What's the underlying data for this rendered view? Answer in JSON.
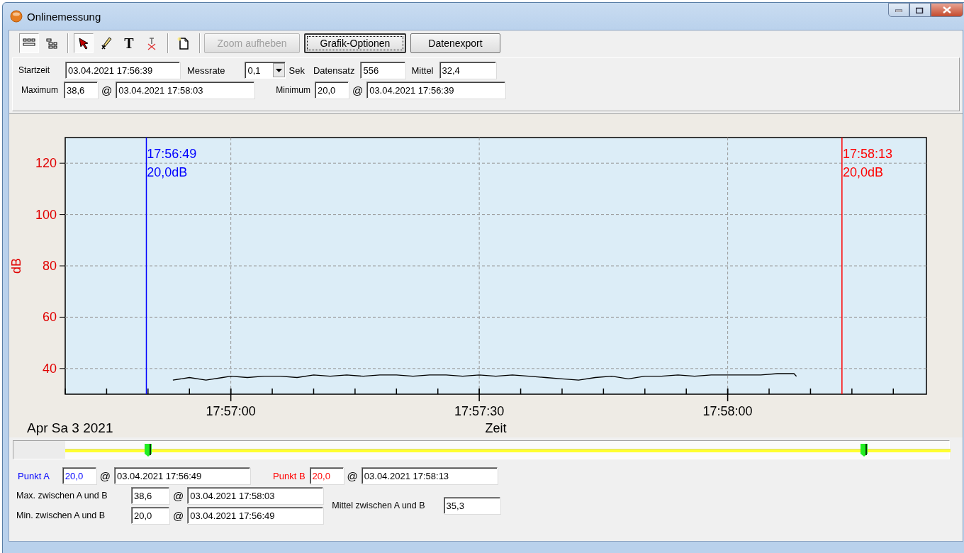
{
  "window": {
    "title": "Onlinemessung"
  },
  "toolbar": {
    "tool_groups": [
      [
        {
          "kind": "grid",
          "selected": true
        },
        {
          "kind": "tree",
          "selected": false
        }
      ],
      [
        {
          "kind": "arrow",
          "selected": true
        },
        {
          "kind": "pencil",
          "selected": false
        },
        {
          "kind": "text",
          "glyph": "T",
          "selected": false
        },
        {
          "kind": "erase",
          "selected": false
        }
      ],
      [
        {
          "kind": "page",
          "selected": false
        }
      ]
    ],
    "buttons": [
      {
        "label": "Zoom aufheben",
        "disabled": true,
        "focused": false
      },
      {
        "label": "Grafik-Optionen",
        "disabled": false,
        "focused": true
      },
      {
        "label": "Datenexport",
        "disabled": false,
        "focused": false
      }
    ]
  },
  "measurement": {
    "start_label": "Startzeit",
    "start_value": "03.04.2021 17:56:39",
    "rate_label": "Messrate",
    "rate_value": "0,1",
    "rate_unit": "Sek",
    "records_label": "Datensatz",
    "records_value": "556",
    "mean_label": "Mittel",
    "mean_value": "32,4",
    "max_label": "Maximum",
    "max_value": "38,6",
    "max_at": "@",
    "max_time": "03.04.2021 17:58:03",
    "min_label": "Minimum",
    "min_value": "20,0",
    "min_at": "@",
    "min_time": "03.04.2021 17:56:39"
  },
  "graph": {
    "date_label": "Apr Sa 3 2021",
    "cursors": [
      {
        "time": "17:56:49",
        "reading": "20,0dB",
        "color": "#0000ff",
        "level": 0.094
      },
      {
        "time": "17:58:13",
        "reading": "20,0dB",
        "color": "#ff0000",
        "level": 0.902
      }
    ],
    "chart_data": {
      "type": "line",
      "xlabel": "Zeit",
      "ylabel": "dB",
      "grid": true,
      "xlim": [
        64600,
        64704
      ],
      "ylim": [
        30,
        130
      ],
      "ref_lines": [
        {
          "axis": "x",
          "value": 64609.8,
          "color": "#0000ff"
        },
        {
          "axis": "x",
          "value": 64693.8,
          "color": "#ff0000"
        }
      ],
      "xticks": [
        {
          "value": 64620,
          "label": "17:57:00"
        },
        {
          "value": 64650,
          "label": "17:57:30"
        },
        {
          "value": 64680,
          "label": "17:58:00"
        }
      ],
      "yticks": [
        40,
        60,
        80,
        100,
        120
      ],
      "x": [
        64613,
        64615,
        64617,
        64619,
        64620,
        64622,
        64624,
        64626,
        64628,
        64630,
        64632,
        64634,
        64636,
        64638,
        64640,
        64642,
        64644,
        64646,
        64648,
        64650,
        64652,
        64654,
        64656,
        64658,
        64660,
        64662,
        64664,
        64666,
        64668,
        64670,
        64672,
        64674,
        64676,
        64678,
        64680,
        64682,
        64684,
        64686,
        64688,
        64688.3
      ],
      "series": [
        {
          "color": "#000000",
          "values": [
            35.5,
            36.5,
            35.5,
            36.5,
            37,
            36.5,
            37,
            37,
            36.5,
            37.5,
            37,
            37.5,
            37,
            37.5,
            37.5,
            37,
            37.5,
            37.5,
            37,
            37.5,
            37,
            37.5,
            37,
            36.5,
            36,
            35.5,
            36.5,
            37,
            36,
            37,
            37,
            37.5,
            37,
            37.5,
            37.5,
            37.5,
            37.5,
            38,
            38,
            37
          ]
        }
      ]
    }
  },
  "point_a": {
    "label": "Punkt A",
    "value": "20,0",
    "at": "@",
    "time": "03.04.2021 17:56:49"
  },
  "point_b": {
    "label": "Punkt B",
    "value": "20,0",
    "at": "@",
    "time": "03.04.2021 17:58:13"
  },
  "between": {
    "max_label": "Max. zwischen A und B",
    "max_value": "38,6",
    "max_at": "@",
    "max_time": "03.04.2021 17:58:03",
    "min_label": "Min. zwischen A und B",
    "min_value": "20,0",
    "min_at": "@",
    "min_time": "03.04.2021 17:56:49",
    "mean_label": "Mittel zwischen A und B",
    "mean_value": "35,3"
  }
}
